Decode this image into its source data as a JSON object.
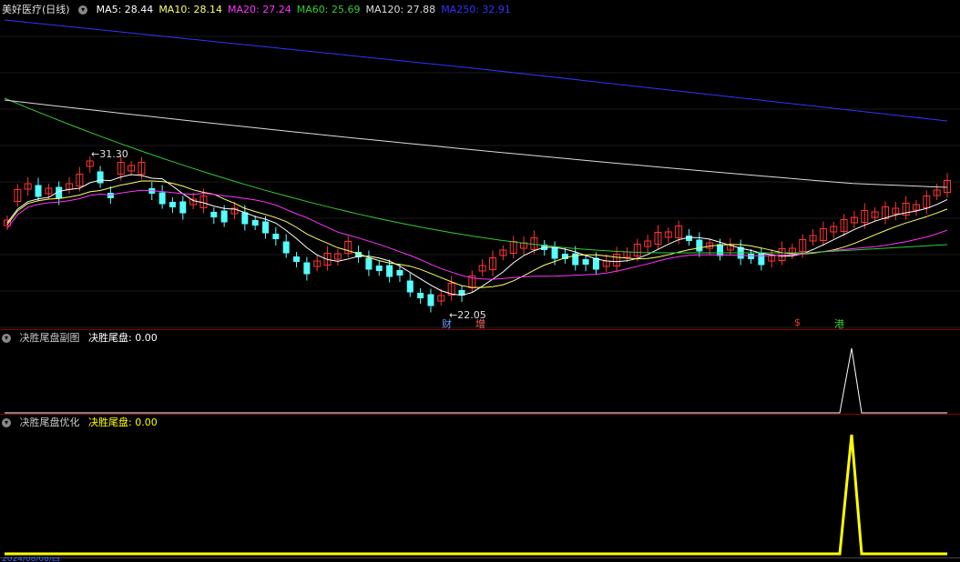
{
  "main": {
    "title": "美好医疗(日线)",
    "ma_labels": [
      {
        "text": "MA5: 28.44",
        "color": "#ffffff"
      },
      {
        "text": "MA10: 28.14",
        "color": "#ffff66"
      },
      {
        "text": "MA20: 27.24",
        "color": "#ff33ff"
      },
      {
        "text": "MA60: 25.69",
        "color": "#33cc33"
      },
      {
        "text": "MA120: 27.88",
        "color": "#dddddd"
      },
      {
        "text": "MA250: 32.91",
        "color": "#3333ff"
      }
    ],
    "high_label": "31.30",
    "low_label": "22.05",
    "markers": [
      {
        "text": "财",
        "color": "#6699ff"
      },
      {
        "text": "增",
        "color": "#ff6666"
      },
      {
        "text": "$",
        "color": "#ff3333"
      },
      {
        "text": "港",
        "color": "#33cc33"
      }
    ]
  },
  "sub1": {
    "name": "决胜尾盘副图",
    "value_label": "决胜尾盘: 0.00",
    "line_color": "#ffffff"
  },
  "sub2": {
    "name": "决胜尾盘优化",
    "value_label": "决胜尾盘: 0.00",
    "line_color": "#ffff00"
  },
  "bottom_axis": {
    "date_label": "2024/08/08/四"
  },
  "colors": {
    "up": "#ff3333",
    "down": "#54ffff",
    "separator": "#8b0000"
  }
}
